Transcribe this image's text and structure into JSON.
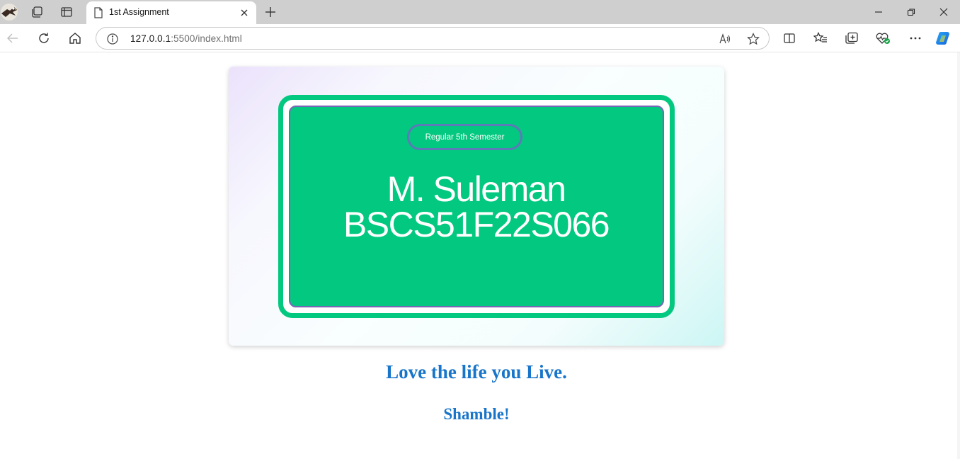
{
  "tab": {
    "title": "1st Assignment"
  },
  "address": {
    "host": "127.0.0.1",
    "rest": ":5500/index.html"
  },
  "icons": {
    "profile": "eagle-avatar-icon",
    "workspaces": "workspaces-icon",
    "tab_actions": "vertical-tabs-icon",
    "page": "page-icon",
    "close_tab": "close-icon",
    "new_tab": "plus-icon",
    "minimize": "minimize-icon",
    "restore": "restore-icon",
    "close_window": "close-icon",
    "back": "back-arrow-icon",
    "refresh": "refresh-icon",
    "home": "home-icon",
    "site_info": "info-icon",
    "read_aloud": "read-aloud-icon",
    "favorite": "star-icon",
    "split_screen": "split-screen-icon",
    "favorites": "favorites-icon",
    "collections": "collections-icon",
    "browser_essentials": "heart-pulse-icon",
    "more": "more-dots-icon",
    "copilot": "copilot-icon"
  },
  "card": {
    "badge": "Regular 5th Semester",
    "name": "M. Suleman",
    "roll_no": "BSCS51F22S066"
  },
  "headline": "Love the life you Live.",
  "subheadline": "Shamble!",
  "colors": {
    "accent_green": "#03c87f",
    "inner_border": "#7668b5",
    "pill_border": "#5c79b8",
    "heading_blue": "#1875c9"
  }
}
